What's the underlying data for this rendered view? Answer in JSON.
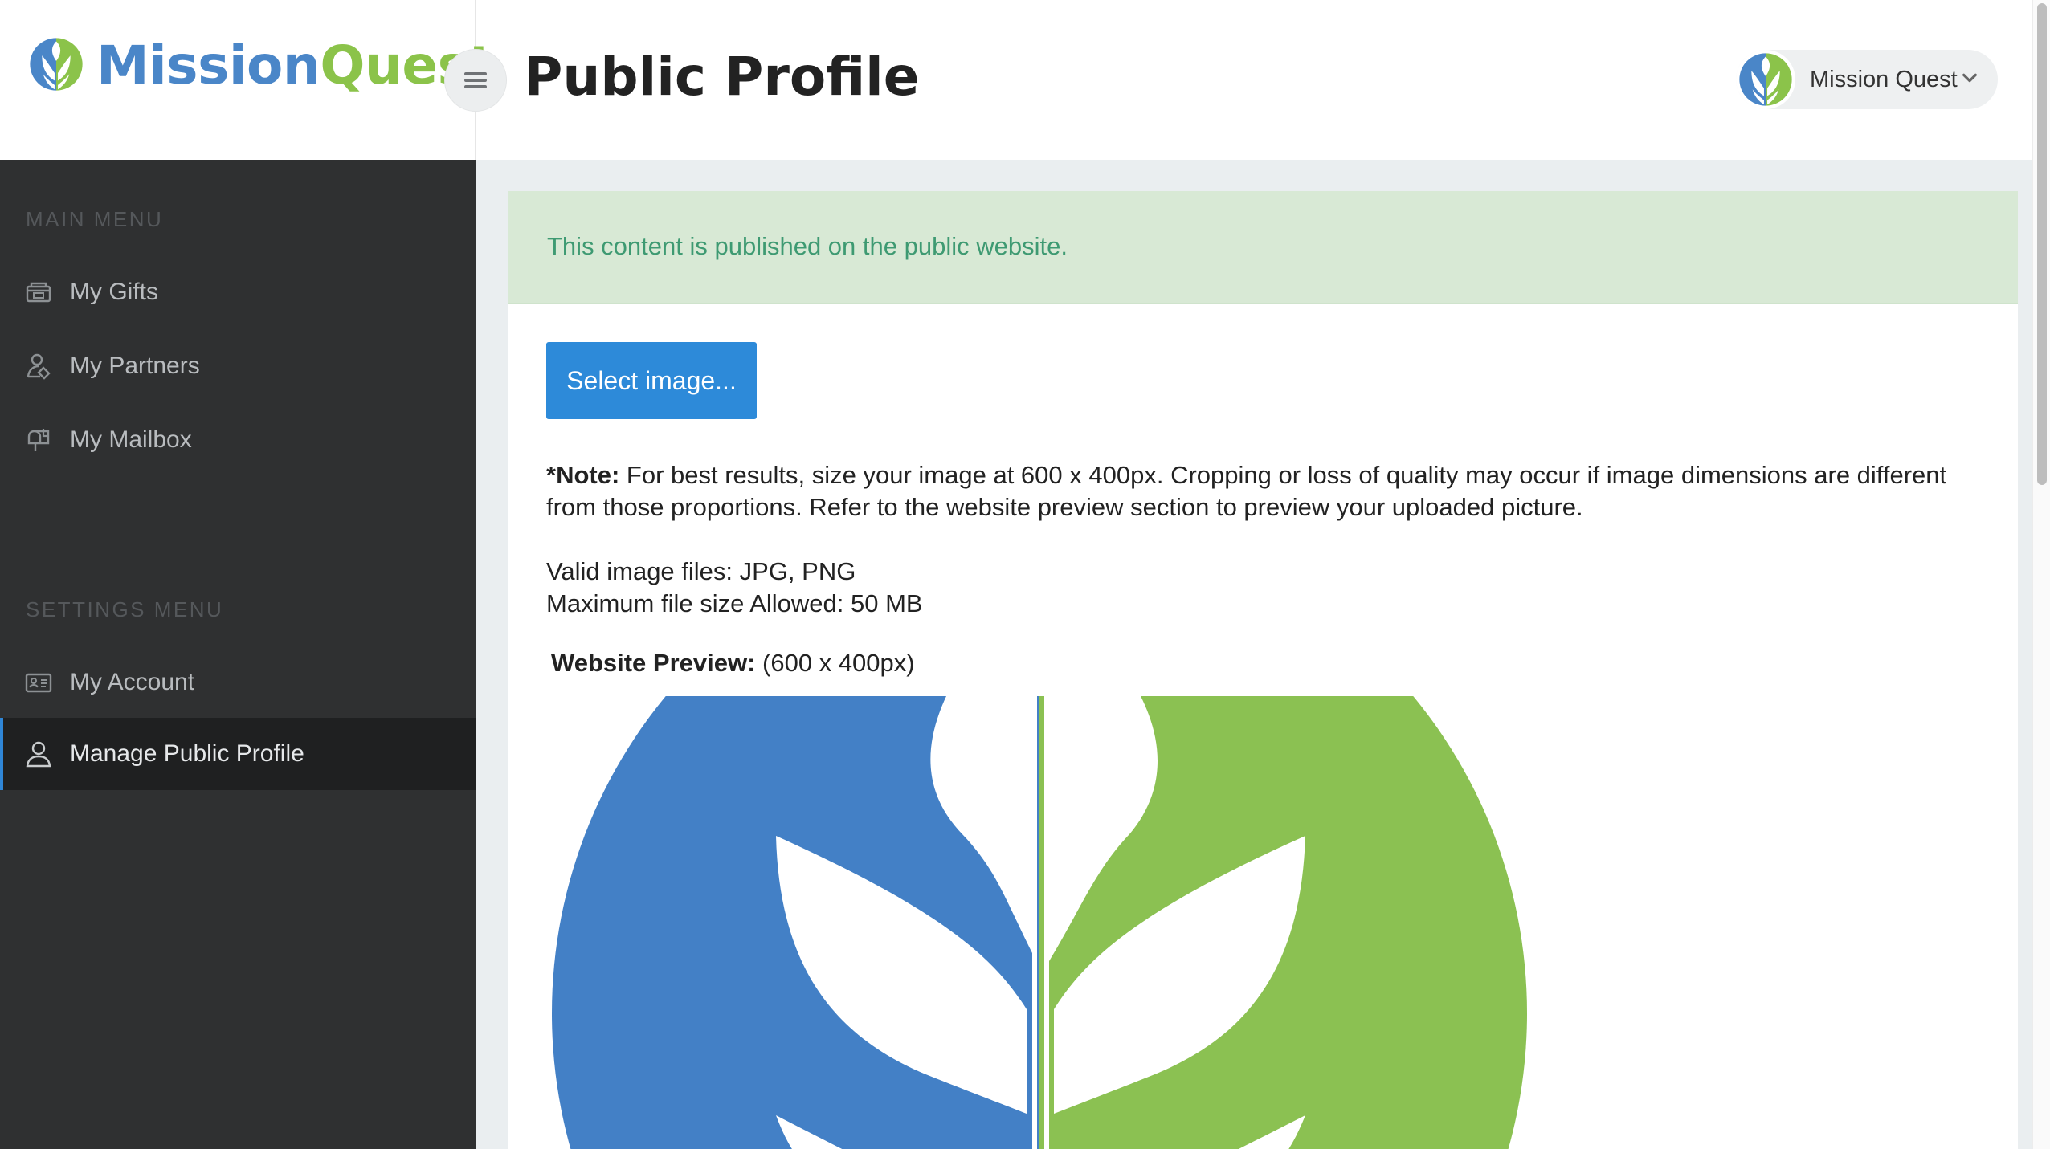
{
  "brand": {
    "name_part1": "Mission",
    "name_part2": "Quest",
    "colors": {
      "blue": "#4a86c8",
      "green": "#8bc34a",
      "accent": "#2d8ad9"
    }
  },
  "header": {
    "page_title": "Public Profile",
    "menu_toggle_icon": "hamburger-icon",
    "account": {
      "name": "Mission Quest",
      "dropdown_icon": "chevron-down-icon"
    }
  },
  "sidebar": {
    "main_menu_title": "MAIN MENU",
    "main_items": [
      {
        "label": "My Gifts",
        "icon": "gift-icon"
      },
      {
        "label": "My Partners",
        "icon": "partners-icon"
      },
      {
        "label": "My Mailbox",
        "icon": "mailbox-icon"
      }
    ],
    "settings_menu_title": "SETTINGS MENU",
    "settings_items": [
      {
        "label": "My Account",
        "icon": "id-card-icon"
      },
      {
        "label": "Manage Public Profile",
        "icon": "user-icon",
        "active": true
      }
    ]
  },
  "content": {
    "alert_text": "This content is published on the public website.",
    "select_button_label": "Select image...",
    "note_bold": "*Note:",
    "note_text": "For best results, size your image at 600 x 400px. Cropping or loss of quality may occur if image dimensions are different from those proportions. Refer to the website preview section to preview your uploaded picture.",
    "valid_files": "Valid image files: JPG, PNG",
    "max_size": "Maximum file size Allowed: 50 MB",
    "preview_bold": "Website Preview:",
    "preview_dims": "(600 x 400px)"
  }
}
